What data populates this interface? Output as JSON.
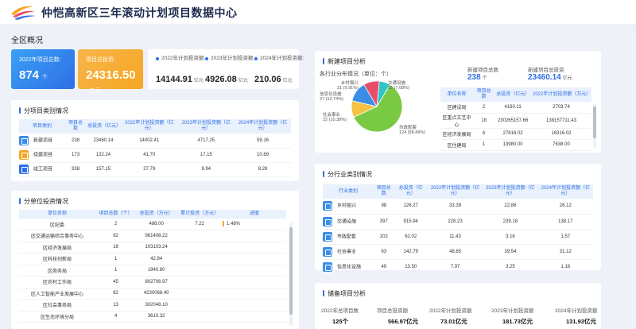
{
  "app": {
    "title": "仲恺高新区三年滚动计划项目数据中心"
  },
  "overview": {
    "heading": "全区概况",
    "kpis": [
      {
        "label": "2022年项目总数:",
        "value": "874",
        "unit": "个"
      },
      {
        "label": "项目总投资:",
        "value": "24316.50",
        "unit": "亿元"
      }
    ],
    "years": [
      {
        "label": "2022年计划投资额:",
        "value": "14144.91",
        "unit": "亿元"
      },
      {
        "label": "2023年计划投资额:",
        "value": "4926.08",
        "unit": "亿元"
      },
      {
        "label": "2024年计划投资额:",
        "value": "210.06",
        "unit": "亿元"
      }
    ]
  },
  "category": {
    "title": "分项目类别情况",
    "headers": [
      "项目类别",
      "项目总数",
      "总投资（亿元）",
      "2022年计划投资额（亿元）",
      "2023年计划投资额（亿元）",
      "2024年计划投资额（亿元）"
    ],
    "rows": [
      {
        "icon": "new-project-icon",
        "color": "#3a8ee6",
        "cells": [
          "新建项目",
          "238",
          "23460.14",
          "14002.41",
          "4717.25",
          "59.16"
        ]
      },
      {
        "icon": "continuing-project-icon",
        "color": "#f5a623",
        "cells": [
          "续建项目",
          "173",
          "132.24",
          "41.70",
          "17.15",
          "10.69"
        ]
      },
      {
        "icon": "completed-project-icon",
        "color": "#2f6fe6",
        "cells": [
          "竣工项目",
          "338",
          "157.15",
          "27.79",
          "9.94",
          "8.28"
        ]
      }
    ]
  },
  "unit": {
    "title": "分单位投资情况",
    "headers": [
      "单位名称",
      "项目总数（个）",
      "总投资（万元）",
      "累计投资（万元）",
      "进度"
    ],
    "rows": [
      {
        "cells": [
          "区纪委",
          "2",
          "488.00",
          "7.22"
        ],
        "progress_text": "1.48%",
        "progress": 0.0148
      },
      {
        "cells": [
          "区交通运输综合事务中心",
          "92",
          "961408.22",
          "",
          ""
        ],
        "progress_text": "",
        "progress": 0
      },
      {
        "cells": [
          "区经济发展局",
          "16",
          "103103.24",
          "",
          ""
        ],
        "progress_text": "",
        "progress": 0
      },
      {
        "cells": [
          "区科技创新局",
          "1",
          "42.84",
          "",
          ""
        ],
        "progress_text": "",
        "progress": 0
      },
      {
        "cells": [
          "区商务局",
          "1",
          "1940.80",
          "",
          ""
        ],
        "progress_text": "",
        "progress": 0
      },
      {
        "cells": [
          "区农村工作局",
          "45",
          "802706.97",
          "",
          ""
        ],
        "progress_text": "",
        "progress": 0
      },
      {
        "cells": [
          "区人工智能产业发展中心",
          "82",
          "4230068.40",
          "",
          ""
        ],
        "progress_text": "",
        "progress": 0
      },
      {
        "cells": [
          "区社会事务局",
          "13",
          "302048.10",
          "",
          ""
        ],
        "progress_text": "",
        "progress": 0
      },
      {
        "cells": [
          "区生态环境分局",
          "4",
          "3610.32",
          "",
          ""
        ],
        "progress_text": "",
        "progress": 0
      }
    ]
  },
  "newproj": {
    "title": "新建项目分析",
    "pie_title": "各行业分布情况（单位：个）",
    "total_label": "新建项目总数",
    "total_value": "238",
    "total_unit": "个",
    "invest_label": "新建项目总投资",
    "invest_value": "23460.14",
    "invest_unit": "亿元",
    "headers": [
      "单位名称",
      "项目总数",
      "总投资（亿元）",
      "2022年计划投资额（万元）"
    ],
    "rows": [
      [
        "区建设局",
        "2",
        "4190.11",
        "2703.74"
      ],
      [
        "区重点文艺中心",
        "18",
        "230265157.66",
        "138157711.43"
      ],
      [
        "区经济发展局",
        "6",
        "27816.02",
        "16316.02"
      ],
      [
        "区住建局",
        "1",
        "13980.00",
        "7638.00"
      ]
    ]
  },
  "chart_data": {
    "type": "pie",
    "title": "各行业分布情况（单位：个）",
    "slices": [
      {
        "label": "市政配套",
        "value": 124,
        "pct_text": "124 (58.49%)",
        "color": "#7ac943"
      },
      {
        "label": "社会事业",
        "value": 22,
        "pct_text": "22 (10.38%)",
        "color": "#f5c242"
      },
      {
        "label": "信息化设施",
        "value": 27,
        "pct_text": "27 (12.74%)",
        "color": "#3a8ee6"
      },
      {
        "label": "乡村振兴",
        "value": 21,
        "pct_text": "21 (9.91%)",
        "color": "#e84d6a"
      },
      {
        "label": "交通设施",
        "value": 15,
        "pct_text": "15 (7.08%)",
        "color": "#2fc5c9"
      }
    ]
  },
  "industry": {
    "title": "分行业类别情况",
    "headers": [
      "行业类别",
      "项目总数",
      "总投资（亿元）",
      "2022年计划投资额（亿元）",
      "2023年计划投资额（亿元）",
      "2024年计划投资额（亿元）"
    ],
    "rows": [
      {
        "icon": "rural-revitalization-icon",
        "cells": [
          "乡村振兴",
          "98",
          "126.27",
          "33.39",
          "22.86",
          "26.12"
        ]
      },
      {
        "icon": "transport-facility-icon",
        "cells": [
          "交通设施",
          "397",
          "915.94",
          "228.23",
          "239.18",
          "138.17"
        ]
      },
      {
        "icon": "municipal-facility-icon",
        "cells": [
          "市政配套",
          "202",
          "62.02",
          "11.43",
          "3.16",
          "1.57"
        ]
      },
      {
        "icon": "social-affairs-icon",
        "cells": [
          "社会事业",
          "63",
          "142.79",
          "48.85",
          "39.54",
          "31.12"
        ]
      },
      {
        "icon": "it-facility-icon",
        "cells": [
          "信息化设施",
          "49",
          "13.50",
          "7.97",
          "3.25",
          "1.16"
        ]
      }
    ]
  },
  "reserve": {
    "title": "储备项目分析",
    "items": [
      {
        "label": "2022年总项目数",
        "value": "125个"
      },
      {
        "label": "项目总投资额",
        "value": "566.97亿元"
      },
      {
        "label": "2022年计划投资额",
        "value": "73.01亿元"
      },
      {
        "label": "2023年计划投资额",
        "value": "181.73亿元"
      },
      {
        "label": "2024年计划投资额",
        "value": "131.93亿元"
      }
    ]
  }
}
